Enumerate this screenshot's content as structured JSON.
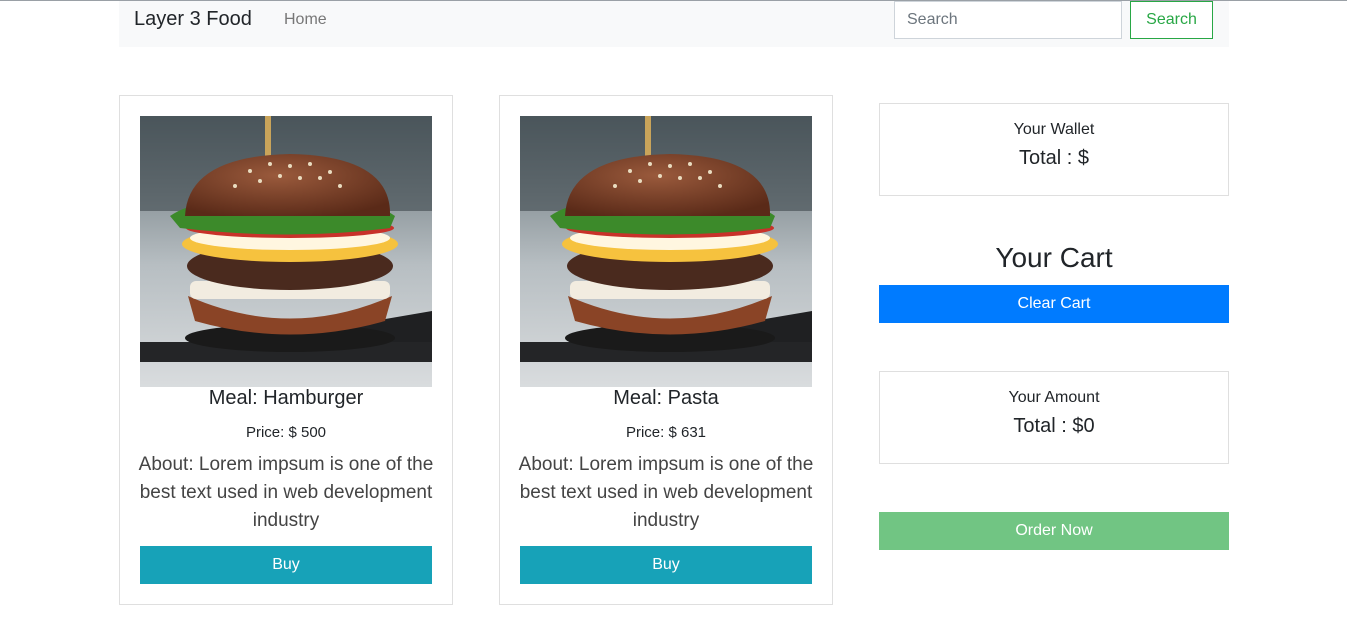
{
  "navbar": {
    "brand": "Layer 3 Food",
    "home_link": "Home",
    "search_placeholder": "Search",
    "search_button": "Search"
  },
  "products": [
    {
      "meal": "Meal: Hamburger",
      "price": "Price: $ 500",
      "about": "About: Lorem impsum is one of the best text used in web development industry",
      "buy_label": "Buy",
      "image_icon": "hamburger-photo"
    },
    {
      "meal": "Meal: Pasta",
      "price": "Price: $ 631",
      "about": "About: Lorem impsum is one of the best text used in web development industry",
      "buy_label": "Buy",
      "image_icon": "hamburger-photo"
    }
  ],
  "wallet": {
    "title": "Your Wallet",
    "total": "Total : $"
  },
  "cart": {
    "title": "Your Cart",
    "clear_label": "Clear Cart"
  },
  "amount": {
    "title": "Your Amount",
    "total": "Total : $0"
  },
  "order_label": "Order Now",
  "colors": {
    "buy": "#17a2b8",
    "clear": "#007bff",
    "order": "#71c583",
    "search_outline": "#28a745"
  }
}
